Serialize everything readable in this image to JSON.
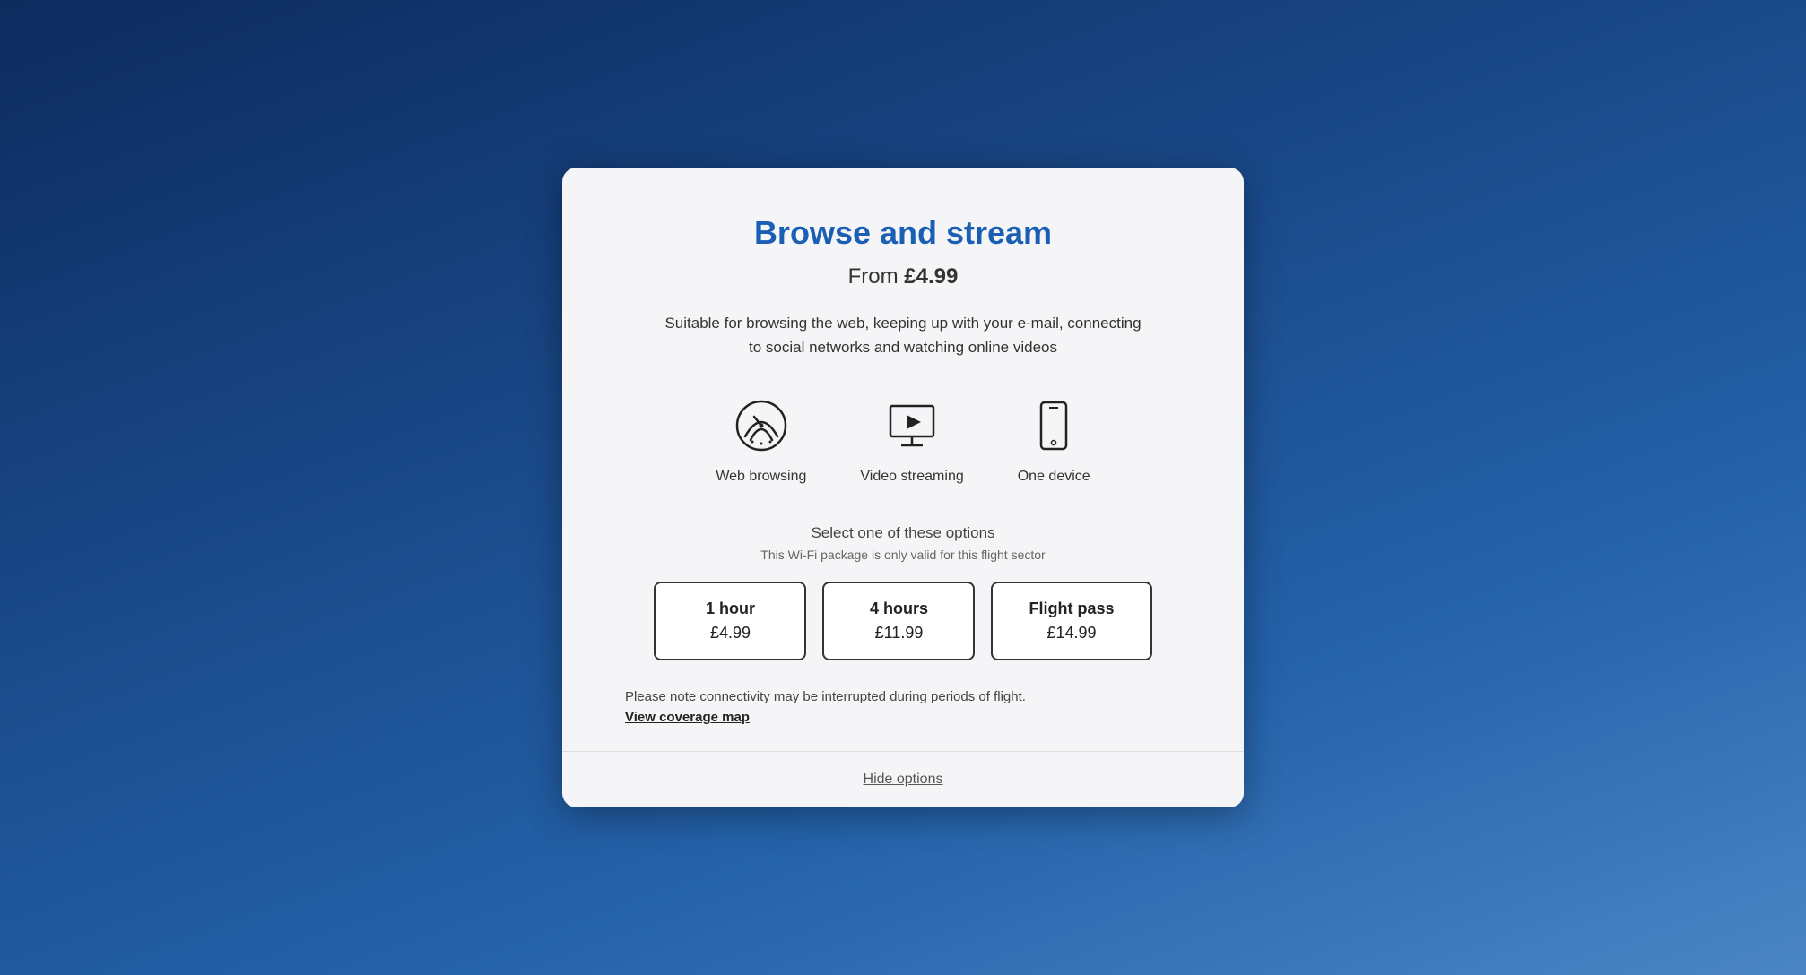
{
  "background": {
    "color_start": "#0d2b5e",
    "color_end": "#4a85c5"
  },
  "modal": {
    "title": "Browse and stream",
    "price_prefix": "From ",
    "price": "£4.99",
    "description": "Suitable for browsing the web, keeping up with your e-mail, connecting to social networks and watching online videos",
    "features": [
      {
        "id": "web-browsing",
        "label": "Web browsing",
        "icon": "wifi-icon"
      },
      {
        "id": "video-streaming",
        "label": "Video streaming",
        "icon": "play-icon"
      },
      {
        "id": "one-device",
        "label": "One device",
        "icon": "mobile-icon"
      }
    ],
    "select_options_title": "Select one of these options",
    "select_options_subtitle": "This Wi-Fi package is only valid for this flight sector",
    "options": [
      {
        "duration": "1 hour",
        "price": "£4.99"
      },
      {
        "duration": "4 hours",
        "price": "£11.99"
      },
      {
        "duration": "Flight pass",
        "price": "£14.99"
      }
    ],
    "note_text": "Please note connectivity may be interrupted during periods of flight.",
    "coverage_link": "View coverage map",
    "hide_options_label": "Hide options"
  }
}
